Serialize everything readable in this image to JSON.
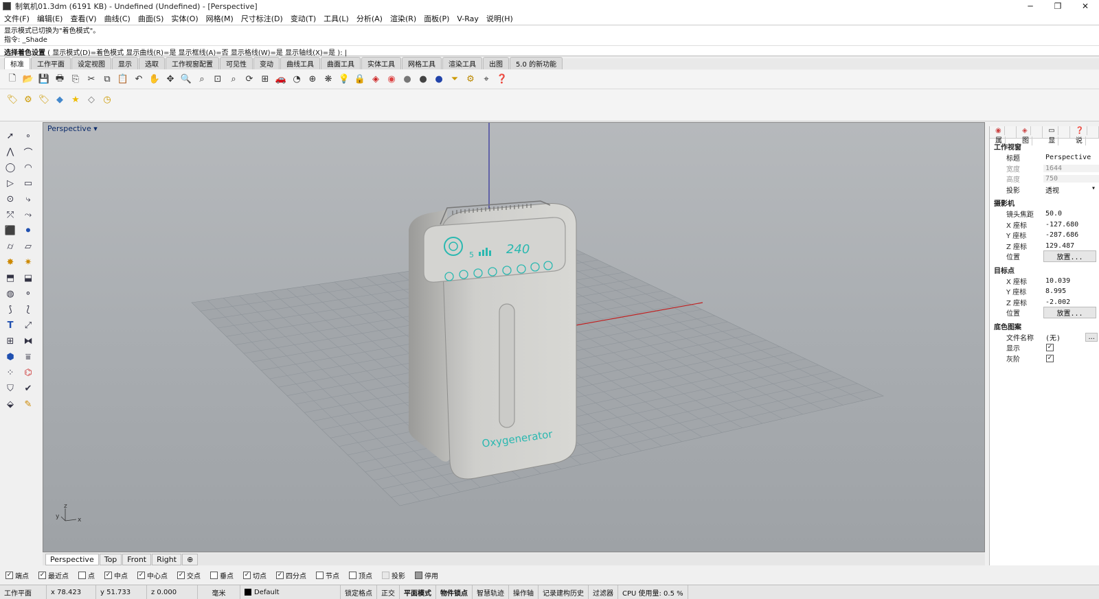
{
  "window": {
    "title": "制氧机01.3dm (6191 KB) - Undefined (Undefined) - [Perspective]",
    "controls": [
      "─",
      "❐",
      "✕"
    ]
  },
  "menu": [
    "文件(F)",
    "编辑(E)",
    "查看(V)",
    "曲线(C)",
    "曲面(S)",
    "实体(O)",
    "网格(M)",
    "尺寸标注(D)",
    "变动(T)",
    "工具(L)",
    "分析(A)",
    "渲染(R)",
    "面板(P)",
    "V-Ray",
    "说明(H)"
  ],
  "command": {
    "history_line1": "显示模式已切换为\"着色模式\"。",
    "history_line2": "指令: _Shade",
    "prompt_bold": "选择着色设置",
    "prompt_rest": " ( 显示模式(D)=着色模式  显示曲线(R)=是  显示框线(A)=否  显示格线(W)=是  显示轴线(X)=是 ): |"
  },
  "toolbar_tabs": [
    "标准",
    "工作平面",
    "设定视图",
    "显示",
    "选取",
    "工作视窗配置",
    "可见性",
    "变动",
    "曲线工具",
    "曲面工具",
    "实体工具",
    "网格工具",
    "渲染工具",
    "出图",
    "5.0 的新功能"
  ],
  "toolbar_icons": [
    "new-file-icon",
    "open-folder-icon",
    "save-icon",
    "print-icon",
    "import-icon",
    "cut-icon",
    "copy-icon",
    "paste-icon",
    "undo-icon",
    "pan-hand-icon",
    "move-view-icon",
    "zoom-in-icon",
    "zoom-window-icon",
    "zoom-extents-icon",
    "zoom-selected-icon",
    "rotate-view-icon",
    "four-viewports-icon",
    "car-icon",
    "named-view-icon",
    "camera-icon",
    "properties-icon",
    "light-bulb-icon",
    "lock-icon",
    "material-icon",
    "color-wheel-icon",
    "sphere-shaded-icon",
    "sphere-rendered-icon",
    "sphere-blue-icon",
    "filter-icon",
    "settings-gear-icon",
    "snap-icon",
    "help-icon"
  ],
  "toolbar2_icons": [
    "tag-icon",
    "tag-settings-icon",
    "tag-edit-icon",
    "box-blue-icon",
    "star-icon",
    "tag-outline-icon",
    "clock-icon"
  ],
  "side_tools": [
    "select-arrow-icon",
    "point-icon",
    "polyline-icon",
    "curve-icon",
    "circle-icon",
    "arc-icon",
    "triangle-icon",
    "rectangle-icon",
    "ellipse-icon",
    "fillet-icon",
    "transform-icon",
    "curve-edit-icon",
    "box-icon",
    "spheres-icon",
    "cylinder-icon",
    "plane-icon",
    "boolean-icon",
    "explode-icon",
    "extrude-icon",
    "offset-icon",
    "blend-icon",
    "join-icon",
    "pipe-icon",
    "split-icon",
    "text-icon",
    "dimension-icon",
    "group-icon",
    "mirror-icon",
    "mesh-icon",
    "layer-icon",
    "array-icon",
    "hierarchy-icon",
    "analyze-icon",
    "check-icon",
    "solid-edit-icon",
    "brush-icon"
  ],
  "viewport": {
    "label": "Perspective",
    "device_brand": "Oxygenerator",
    "device_display": "240",
    "axis_labels": {
      "x": "x",
      "y": "y",
      "z": "z"
    },
    "tabs": [
      "Perspective",
      "Top",
      "Front",
      "Right"
    ],
    "add_tab": "⊕"
  },
  "panel": {
    "tabs": [
      "属",
      "图",
      "显",
      "说"
    ],
    "section_viewport": "工作视窗",
    "title_label": "标题",
    "title_value": "Perspective",
    "width_label": "宽度",
    "width_value": "1644",
    "height_label": "高度",
    "height_value": "750",
    "projection_label": "投影",
    "projection_value": "透视",
    "section_camera": "摄影机",
    "focal_label": "镜头焦距",
    "focal_value": "50.0",
    "cam_x_label": "X 座标",
    "cam_x": "-127.680",
    "cam_y_label": "Y 座标",
    "cam_y": "-287.686",
    "cam_z_label": "Z 座标",
    "cam_z": "129.487",
    "cam_pos_label": "位置",
    "cam_pos_button": "放置...",
    "section_target": "目标点",
    "tgt_x_label": "X 座标",
    "tgt_x": "10.039",
    "tgt_y_label": "Y 座标",
    "tgt_y": "8.995",
    "tgt_z_label": "Z 座标",
    "tgt_z": "-2.002",
    "tgt_pos_label": "位置",
    "tgt_pos_button": "放置...",
    "section_wallpaper": "底色图案",
    "file_label": "文件名称",
    "file_value": "(无)",
    "file_button": "...",
    "show_label": "显示",
    "gray_label": "灰阶"
  },
  "osnap": [
    {
      "label": "端点",
      "checked": true
    },
    {
      "label": "最近点",
      "checked": true
    },
    {
      "label": "点",
      "checked": false
    },
    {
      "label": "中点",
      "checked": true
    },
    {
      "label": "中心点",
      "checked": true
    },
    {
      "label": "交点",
      "checked": true
    },
    {
      "label": "垂点",
      "checked": false
    },
    {
      "label": "切点",
      "checked": true
    },
    {
      "label": "四分点",
      "checked": true
    },
    {
      "label": "节点",
      "checked": false
    },
    {
      "label": "顶点",
      "checked": false
    },
    {
      "label": "投影",
      "checked": false
    },
    {
      "label": "停用",
      "checked": false
    }
  ],
  "status": {
    "cplane": "工作平面",
    "x": "x 78.423",
    "y": "y 51.733",
    "z": "z 0.000",
    "units": "毫米",
    "layer": "Default",
    "grid_snap": "锁定格点",
    "ortho": "正交",
    "planar": "平面模式",
    "osnap": "物件锁点",
    "smarttrack": "智慧轨迹",
    "gumball": "操作轴",
    "history": "记录建构历史",
    "filter": "过滤器",
    "cpu": "CPU 使用量: 0.5 %"
  }
}
